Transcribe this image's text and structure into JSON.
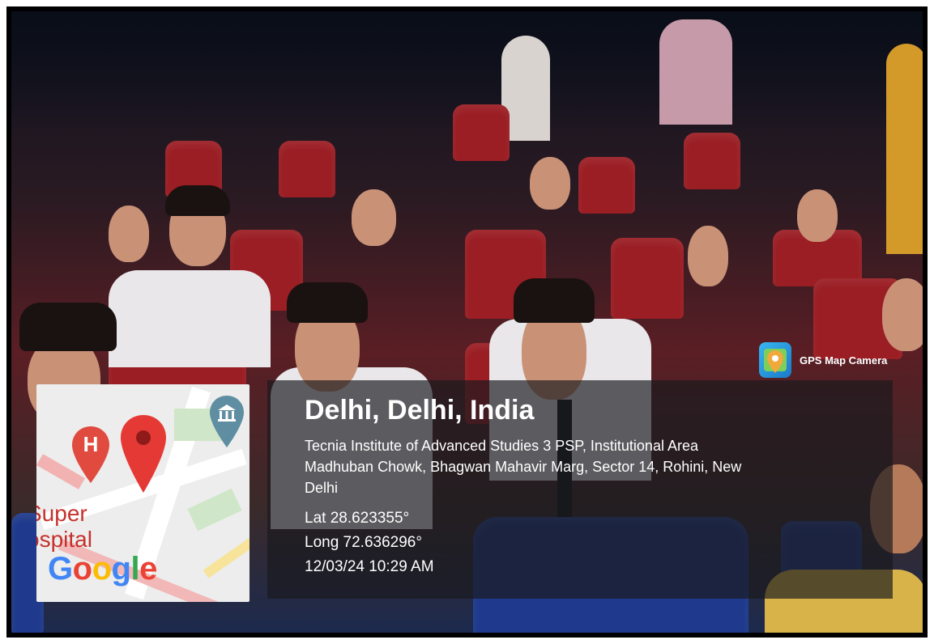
{
  "overlay": {
    "city": "Delhi, Delhi, India",
    "address_line1": "Tecnia Institute of Advanced Studies 3 PSP, Institutional Area",
    "address_line2": "Madhuban Chowk, Bhagwan Mahavir Marg, Sector 14, Rohini, New",
    "address_line3": "Delhi",
    "latitude": "Lat 28.623355°",
    "longitude": "Long 72.636296°",
    "timestamp": "12/03/24 10:29 AM"
  },
  "app": {
    "name": "GPS Map Camera",
    "icon": "map-pin-icon"
  },
  "map": {
    "place_label_1": "Super",
    "place_label_2": "ospital",
    "hospital_marker": "H",
    "logo": [
      "G",
      "o",
      "o",
      "g",
      "l",
      "e"
    ],
    "icons": [
      "hospital-marker-icon",
      "location-pin-icon",
      "museum-icon"
    ]
  },
  "colors": {
    "seat_red": "#9a1e24",
    "seat_blue": "#1f3a8c",
    "panel_bg": "rgba(25,25,30,0.68)",
    "pin_red": "#e53935"
  }
}
